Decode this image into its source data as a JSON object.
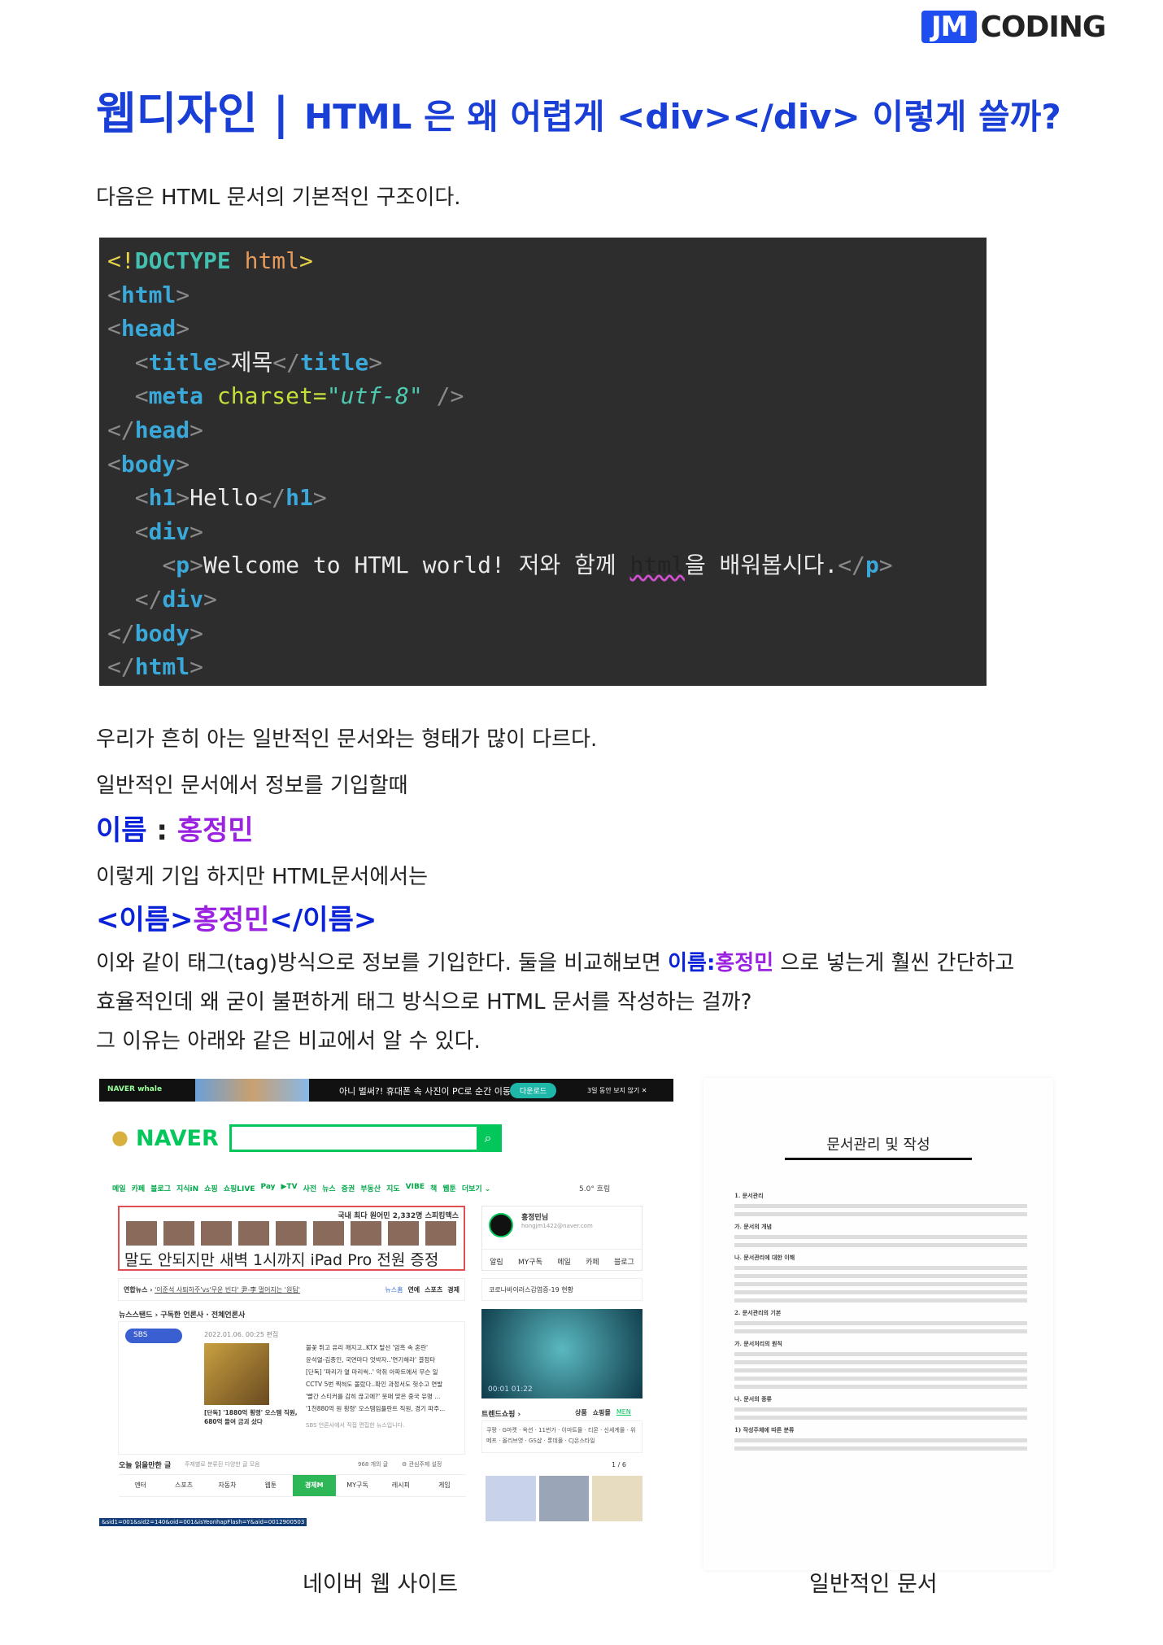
{
  "logo": {
    "jm": "JM",
    "coding": "CODING"
  },
  "title": {
    "category": "웹디자인 | ",
    "headline": "HTML 은 왜 어렵게 <div></div> 이렇게 쓸까?"
  },
  "intro": "다음은 HTML 문서의 기본적인 구조이다.",
  "code_lines": [
    [
      [
        "ex",
        "<!"
      ],
      [
        "dt",
        "DOCTYPE"
      ],
      [
        "tx",
        " "
      ],
      [
        "dh",
        "html"
      ],
      [
        "ex",
        ">"
      ]
    ],
    [
      [
        "br",
        "<"
      ],
      [
        "tg",
        "html"
      ],
      [
        "br",
        ">"
      ]
    ],
    [
      [
        "br",
        "<"
      ],
      [
        "tg",
        "head"
      ],
      [
        "br",
        ">"
      ]
    ],
    [
      [
        "tx",
        "  "
      ],
      [
        "br",
        "<"
      ],
      [
        "tg",
        "title"
      ],
      [
        "br",
        ">"
      ],
      [
        "tx",
        "제목"
      ],
      [
        "br",
        "</"
      ],
      [
        "tg",
        "title"
      ],
      [
        "br",
        ">"
      ]
    ],
    [
      [
        "tx",
        "  "
      ],
      [
        "br",
        "<"
      ],
      [
        "tg",
        "meta"
      ],
      [
        "tx",
        " "
      ],
      [
        "at",
        "charset="
      ],
      [
        "vl",
        "\"utf-8\""
      ],
      [
        "br",
        " />"
      ]
    ],
    [
      [
        "br",
        "</"
      ],
      [
        "tg",
        "head"
      ],
      [
        "br",
        ">"
      ]
    ],
    [
      [
        "br",
        "<"
      ],
      [
        "tg",
        "body"
      ],
      [
        "br",
        ">"
      ]
    ],
    [
      [
        "tx",
        "  "
      ],
      [
        "br",
        "<"
      ],
      [
        "tg",
        "h1"
      ],
      [
        "br",
        ">"
      ],
      [
        "tx",
        "Hello"
      ],
      [
        "br",
        "</"
      ],
      [
        "tg",
        "h1"
      ],
      [
        "br",
        ">"
      ]
    ],
    [
      [
        "tx",
        "  "
      ],
      [
        "br",
        "<"
      ],
      [
        "tg",
        "div"
      ],
      [
        "br",
        ">"
      ]
    ],
    [
      [
        "tx",
        "    "
      ],
      [
        "br",
        "<"
      ],
      [
        "tg",
        "p"
      ],
      [
        "br",
        ">"
      ],
      [
        "tx",
        "Welcome to HTML world! 저와 함께 "
      ],
      [
        "sq",
        "html"
      ],
      [
        "tx",
        "을 배워봅시다."
      ],
      [
        "br",
        "</"
      ],
      [
        "tg",
        "p"
      ],
      [
        "br",
        ">"
      ]
    ],
    [
      [
        "tx",
        "  "
      ],
      [
        "br",
        "</"
      ],
      [
        "tg",
        "div"
      ],
      [
        "br",
        ">"
      ]
    ],
    [
      [
        "br",
        "</"
      ],
      [
        "tg",
        "body"
      ],
      [
        "br",
        ">"
      ]
    ],
    [
      [
        "br",
        "</"
      ],
      [
        "tg",
        "html"
      ],
      [
        "br",
        ">"
      ]
    ]
  ],
  "para1": "우리가 흔히 아는 일반적인 문서와는 형태가 많이 다르다.",
  "para2": "일반적인 문서에서 정보를 기입할때",
  "example1": {
    "label": "이름",
    "sep": " : ",
    "value": "홍정민"
  },
  "para3": "이렇게 기입 하지만 HTML문서에서는",
  "example2": {
    "open": "<이름>",
    "value": "홍정민",
    "close": "</이름>"
  },
  "para4": {
    "before": "이와 같이 태그(tag)방식으로 정보를 기입한다. 둘을 비교해보면 ",
    "label": "이름",
    "sep": ":",
    "value": "홍정민",
    "after": " 으로 넣는게 훨씬 간단하고"
  },
  "para5": "효율적인데 왜 굳이 불편하게 태그 방식으로 HTML 문서를 작성하는 걸까?",
  "para6": "그 이유는 아래와 같은 비교에서 알 수 있다.",
  "naver": {
    "whale": "NAVER whale",
    "banner": "아니 벌써?! 휴대폰 속 사진이 PC로 순간 이동",
    "download": "다운로드",
    "hide": "3일 동안 보지 않기 ✕",
    "logo": "NAVER",
    "nav": [
      "메일",
      "카페",
      "블로그",
      "지식iN",
      "쇼핑",
      "쇼핑LIVE",
      "Pay",
      "▶TV",
      "사전",
      "뉴스",
      "증권",
      "부동산",
      "지도",
      "VIBE",
      "책",
      "웹툰",
      "더보기 ⌄"
    ],
    "weather": "5.0° 흐림",
    "ad_title": "국내 최다 원어민 2,332명 스피킹맥스",
    "ad_text": "말도 안되지만 새벽 1시까지 iPad Pro 전원 증정",
    "profile_name": "홍정민님",
    "profile_email": "hongjm1422@naver.com",
    "profile_tabs": [
      "알림",
      "MY구독",
      "메일",
      "카페",
      "블로그"
    ],
    "news_source": "연합뉴스 ›",
    "news_headline": "'이준석 사퇴하주'vs'무운 빈다' 尹-李 멀어지는 '원팀'",
    "news_tabs": [
      "뉴스홈",
      "연예",
      "스포츠",
      "경제"
    ],
    "issue": "코로나바이러스감염증-19 현황",
    "newsstand": "뉴스스탠드 › 구독한 언론사 · 전체언론사",
    "sbs": "SBS",
    "sbs_date": "2022.01.06. 00:25 편집",
    "headlines": [
      "불꽃 튀고 유리 깨지고..KTX 탈선 '암흑 속 혼란'",
      "윤석열-김종인, 국면마다 엇박자..'연기해라' 결정타",
      "[단독] '파리가 열 마리씩..' 악취 아파트에서 무슨 일",
      "CCTV 5번 찍혀도 몰랐다..확인 과정서도 헛수고 연발",
      "'빨간 스티커를 감히 끊고에?' 뭇매 맞은 중국 유명 ...",
      "'1천880억 원 횡령' 오스템임플란트 직원, 경기 파주..."
    ],
    "photo_caption": "[단독] '1880억 횡령' 오스템 직원, 680억 들여 금괴 샀다",
    "sbs_note": "SBS 언론사에서 직접 편집한 뉴스입니다.",
    "video_time": "00:01 01:22",
    "trend": "트렌드쇼핑 ›",
    "trend_tabs": [
      "상품",
      "쇼핑몰",
      "MEN"
    ],
    "malls": "쿠팡 · G마켓 · 옥션 · 11번가 · 이마트몰 · 티몬 · 신세계몰 · 위메프 · 올리브영 · GS샵 · 롯데몰 · CJ온스타일",
    "pager": "1 / 6",
    "today": "오늘 읽을만한 글",
    "today_sub": "주제별로 분류된 다양한 글 모음",
    "today_count": "968 개의 글",
    "today_setting": "⚙ 관심주제 설정",
    "categories": [
      "엔터",
      "스포츠",
      "자동차",
      "웹툰",
      "경제M",
      "MY구독",
      "레시피",
      "게임"
    ],
    "status_url": "&sid1=001&sid2=140&oid=001&isYeonhapFlash=Y&aid=0012900503"
  },
  "document": {
    "title": "문서관리 및 작성",
    "sections": [
      "1. 문서관리",
      "가. 문서의 개념",
      "나. 문서관리에 대한 이해",
      "2. 문서관리의 기본",
      "가. 문서처리의 원칙",
      "나. 문서의 종류",
      "1) 작성주체에 따른 분류"
    ]
  },
  "captions": {
    "naver": "네이버 웹 사이트",
    "document": "일반적인 문서"
  },
  "colors": {
    "title": "#1a3fd6",
    "tag_blue": "#0a22d8",
    "value_purple": "#9a22e0",
    "naver_green": "#03c75a",
    "code_bg": "#2d2d2d"
  }
}
